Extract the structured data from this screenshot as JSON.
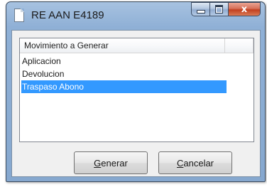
{
  "window": {
    "title": "RE AAN E4189",
    "buttons": {
      "minimize": "minimize",
      "maximize": "maximize",
      "close": "x"
    }
  },
  "listview": {
    "columns": [
      "Movimiento a Generar",
      ""
    ],
    "items": [
      "Aplicacion",
      "Devolucion",
      "Traspaso Abono"
    ],
    "selected_index": 2
  },
  "actions": {
    "generar": {
      "accel": "G",
      "rest": "enerar"
    },
    "cancelar": {
      "accel": "C",
      "rest": "ancelar"
    }
  },
  "colors": {
    "selection": "#3399ff",
    "close_button": "#c2401f",
    "titlebar": "#8fb0d6"
  }
}
